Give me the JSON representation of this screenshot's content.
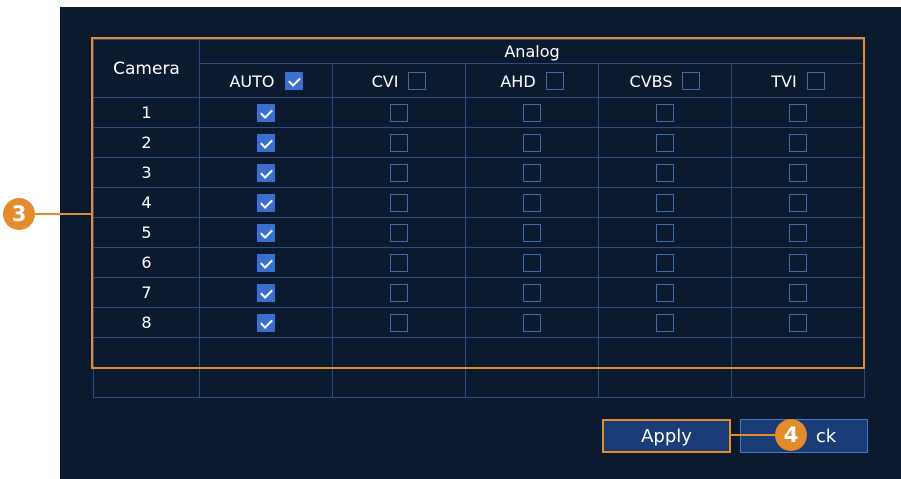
{
  "table": {
    "camera_header": "Camera",
    "group_header": "Analog",
    "columns": [
      {
        "label": "AUTO",
        "checked": true
      },
      {
        "label": "CVI",
        "checked": false
      },
      {
        "label": "AHD",
        "checked": false
      },
      {
        "label": "CVBS",
        "checked": false
      },
      {
        "label": "TVI",
        "checked": false
      }
    ],
    "rows": [
      {
        "camera": "1",
        "auto": true,
        "cvi": false,
        "ahd": false,
        "cvbs": false,
        "tvi": false
      },
      {
        "camera": "2",
        "auto": true,
        "cvi": false,
        "ahd": false,
        "cvbs": false,
        "tvi": false
      },
      {
        "camera": "3",
        "auto": true,
        "cvi": false,
        "ahd": false,
        "cvbs": false,
        "tvi": false
      },
      {
        "camera": "4",
        "auto": true,
        "cvi": false,
        "ahd": false,
        "cvbs": false,
        "tvi": false
      },
      {
        "camera": "5",
        "auto": true,
        "cvi": false,
        "ahd": false,
        "cvbs": false,
        "tvi": false
      },
      {
        "camera": "6",
        "auto": true,
        "cvi": false,
        "ahd": false,
        "cvbs": false,
        "tvi": false
      },
      {
        "camera": "7",
        "auto": true,
        "cvi": false,
        "ahd": false,
        "cvbs": false,
        "tvi": false
      },
      {
        "camera": "8",
        "auto": true,
        "cvi": false,
        "ahd": false,
        "cvbs": false,
        "tvi": false
      }
    ]
  },
  "callouts": {
    "table": "3",
    "apply": "4"
  },
  "buttons": {
    "apply": "Apply",
    "back_visible": "ck"
  },
  "colors": {
    "panel": "#0c1a30",
    "grid": "#2c4c82",
    "accent": "#e48b2b",
    "checkbox_on": "#3b6fcf",
    "button": "#1a3d78"
  }
}
